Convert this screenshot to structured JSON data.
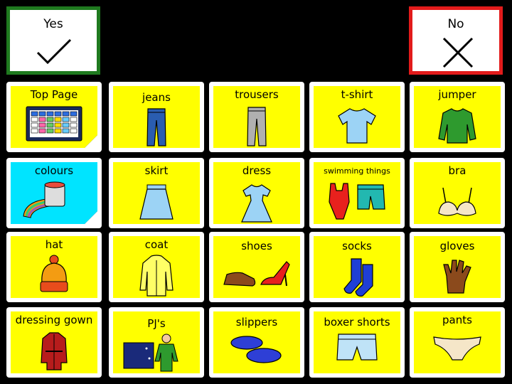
{
  "yes_label": "Yes",
  "no_label": "No",
  "rows": [
    [
      "Top Page",
      "jeans",
      "trousers",
      "t-shirt",
      "jumper"
    ],
    [
      "colours",
      "skirt",
      "dress",
      "swimming things",
      "bra"
    ],
    [
      "hat",
      "coat",
      "shoes",
      "socks",
      "gloves"
    ],
    [
      "dressing gown",
      "PJ's",
      "slippers",
      "boxer shorts",
      "pants"
    ]
  ],
  "colors": {
    "tile_fill": "#ffff00",
    "nav_tile_fill": "#00e4ff",
    "yes_border": "#1f7a1f",
    "no_border": "#e21b1b",
    "background": "#000000"
  },
  "icons": [
    [
      "grid-board-icon",
      "jeans-icon",
      "trousers-icon",
      "t-shirt-icon",
      "jumper-icon"
    ],
    [
      "paint-bucket-icon",
      "skirt-icon",
      "dress-icon",
      "swimwear-icon",
      "bra-icon"
    ],
    [
      "hat-icon",
      "coat-icon",
      "shoes-icon",
      "socks-icon",
      "gloves-icon"
    ],
    [
      "dressing-gown-icon",
      "pyjamas-icon",
      "slippers-icon",
      "boxer-shorts-icon",
      "pants-icon"
    ]
  ]
}
